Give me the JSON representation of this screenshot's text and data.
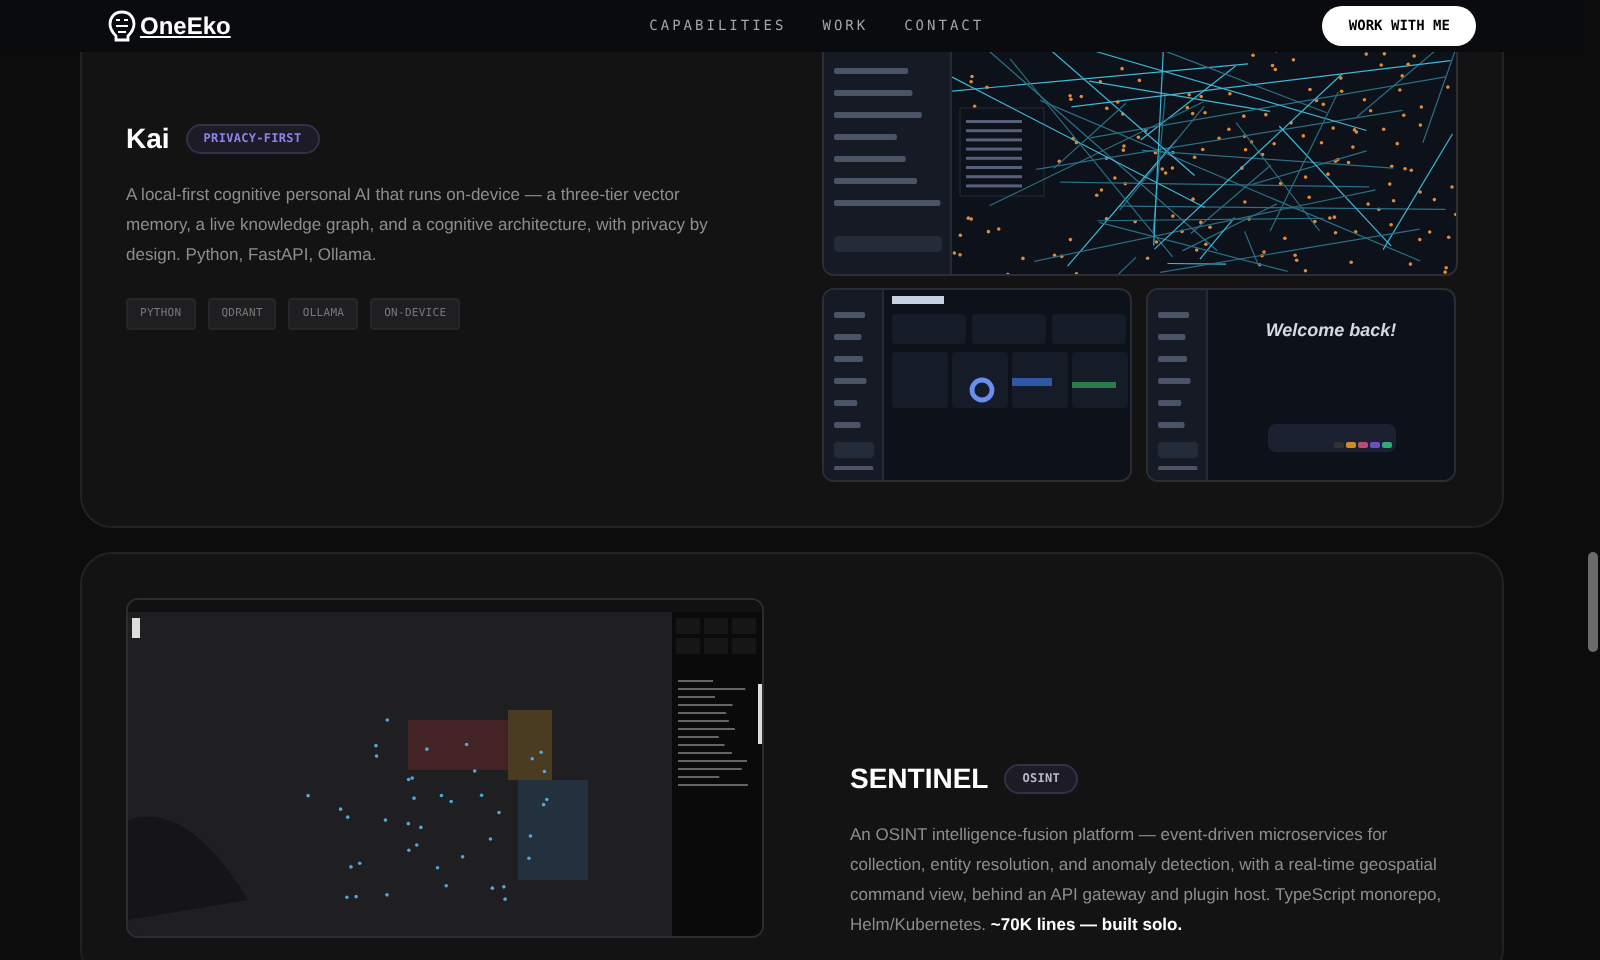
{
  "nav": {
    "logo": "OneEko",
    "links": [
      "CAPABILITIES",
      "WORK",
      "CONTACT"
    ],
    "cta": "WORK WITH ME"
  },
  "projects": [
    {
      "title": "Kai",
      "badge": {
        "text": "PRIVACY-FIRST",
        "color": "#8b85f0"
      },
      "description": "A local-first cognitive personal AI that runs on-device — a three-tier vector memory, a live knowledge graph, and a cognitive architecture, with privacy by design. Python, FastAPI, Ollama.",
      "tags": [
        "PYTHON",
        "QDRANT",
        "OLLAMA",
        "ON-DEVICE"
      ],
      "screens": [
        {
          "kind": "graph"
        },
        {
          "kind": "dashboard"
        },
        {
          "kind": "welcome",
          "heading": "Welcome back!"
        }
      ]
    },
    {
      "title": "SENTINEL",
      "badge": {
        "text": "OSINT",
        "color": "#bbbbbb"
      },
      "description": "An OSINT intelligence-fusion platform — event-driven microservices for collection, entity resolution, and anomaly detection, with a real-time geospatial command view, behind an API gateway and plugin host. TypeScript monorepo, Helm/Kubernetes. **~70K lines — built solo.**",
      "screens": [
        {
          "kind": "map"
        }
      ]
    }
  ]
}
